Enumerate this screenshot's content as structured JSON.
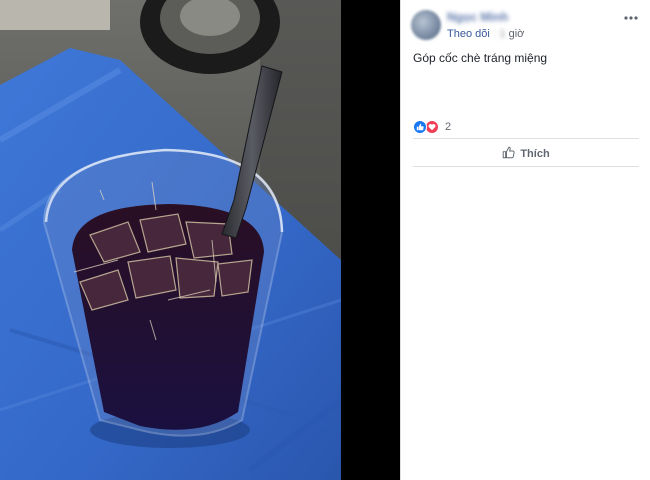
{
  "post": {
    "author": "Ngọc Minh",
    "follow_label": "Theo dõi",
    "separator": "·",
    "time_value": "1",
    "time_unit": "giờ",
    "caption": "Góp cốc chè tráng miệng",
    "reaction_count": "2",
    "like_label": "Thích"
  },
  "icons": {
    "more": "more-options-icon",
    "like_reaction": "like-reaction-icon",
    "love_reaction": "love-reaction-icon",
    "like_button": "thumbs-up-icon"
  },
  "colors": {
    "link": "#385898",
    "like_blue": "#1877f2",
    "love_red": "#f33e58",
    "text": "#1d2129",
    "muted": "#606770",
    "divider": "#dddfe2"
  }
}
